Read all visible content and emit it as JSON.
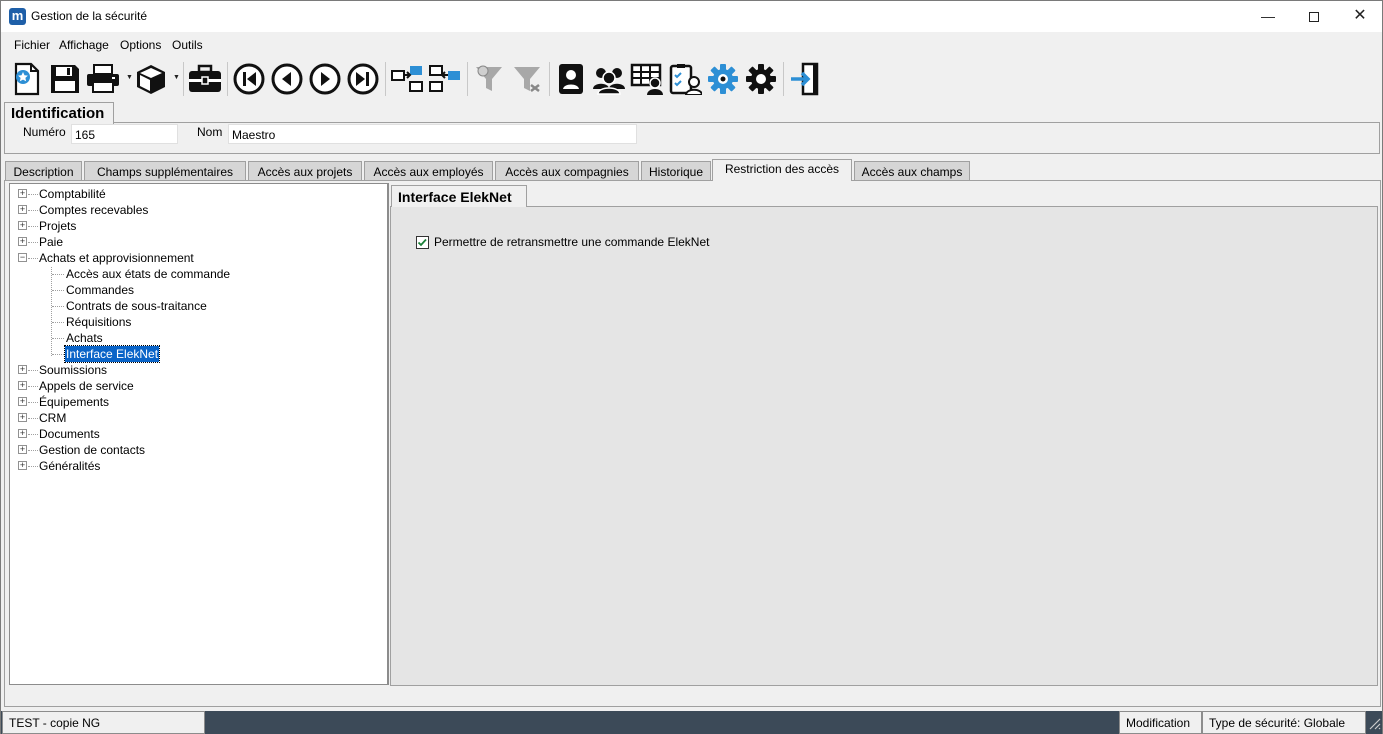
{
  "window": {
    "title": "Gestion de la sécurité",
    "app_icon_letter": "m",
    "minimize_glyph": "—",
    "close_glyph": "✕"
  },
  "menu": {
    "items": [
      {
        "label": "Fichier"
      },
      {
        "label": "Affichage"
      },
      {
        "label": "Options"
      },
      {
        "label": "Outils"
      }
    ]
  },
  "toolbar": {
    "icons": [
      "new-document-icon",
      "save-icon",
      "print-icon",
      "box-icon",
      "briefcase-icon",
      "first-record-icon",
      "previous-record-icon",
      "next-record-icon",
      "last-record-icon",
      "transfer-right-icon",
      "transfer-left-icon",
      "filter-icon",
      "clear-filter-icon",
      "contact-book-icon",
      "users-group-icon",
      "grid-user-icon",
      "checklist-user-icon",
      "settings-blue-icon",
      "settings-icon",
      "exit-icon"
    ]
  },
  "identification": {
    "tab_label": "Identification",
    "numero_label": "Numéro",
    "numero_value": "165",
    "nom_label": "Nom",
    "nom_value": "Maestro"
  },
  "tabs": [
    {
      "label": "Description"
    },
    {
      "label": "Champs supplémentaires"
    },
    {
      "label": "Accès aux projets"
    },
    {
      "label": "Accès aux employés"
    },
    {
      "label": "Accès aux compagnies"
    },
    {
      "label": "Historique"
    },
    {
      "label": "Restriction des accès",
      "active": true
    },
    {
      "label": "Accès aux champs"
    }
  ],
  "tree": {
    "items": [
      {
        "label": "Comptabilité",
        "level": 0,
        "expander": "+"
      },
      {
        "label": "Comptes recevables",
        "level": 0,
        "expander": "+"
      },
      {
        "label": "Projets",
        "level": 0,
        "expander": "+"
      },
      {
        "label": "Paie",
        "level": 0,
        "expander": "+"
      },
      {
        "label": "Achats et approvisionnement",
        "level": 0,
        "expander": "−"
      },
      {
        "label": "Accès aux états de commande",
        "level": 1
      },
      {
        "label": "Commandes",
        "level": 1
      },
      {
        "label": "Contrats de sous-traitance",
        "level": 1
      },
      {
        "label": "Réquisitions",
        "level": 1
      },
      {
        "label": "Achats",
        "level": 1
      },
      {
        "label": "Interface ElekNet",
        "level": 1,
        "selected": true
      },
      {
        "label": "Soumissions",
        "level": 0,
        "expander": "+"
      },
      {
        "label": "Appels de service",
        "level": 0,
        "expander": "+"
      },
      {
        "label": "Équipements",
        "level": 0,
        "expander": "+"
      },
      {
        "label": "CRM",
        "level": 0,
        "expander": "+"
      },
      {
        "label": "Documents",
        "level": 0,
        "expander": "+"
      },
      {
        "label": "Gestion de contacts",
        "level": 0,
        "expander": "+"
      },
      {
        "label": "Généralités",
        "level": 0,
        "expander": "+"
      }
    ]
  },
  "detail": {
    "tab_label": "Interface ElekNet",
    "checkbox_label": "Permettre de retransmettre une commande ElekNet",
    "checkbox_checked": true
  },
  "status": {
    "database": "TEST - copie NG",
    "mode": "Modification",
    "security_type": "Type de sécurité: Globale"
  },
  "colors": {
    "accent": "#0a64c8",
    "status_bar": "#3c4a58",
    "check": "#1a7f37"
  }
}
